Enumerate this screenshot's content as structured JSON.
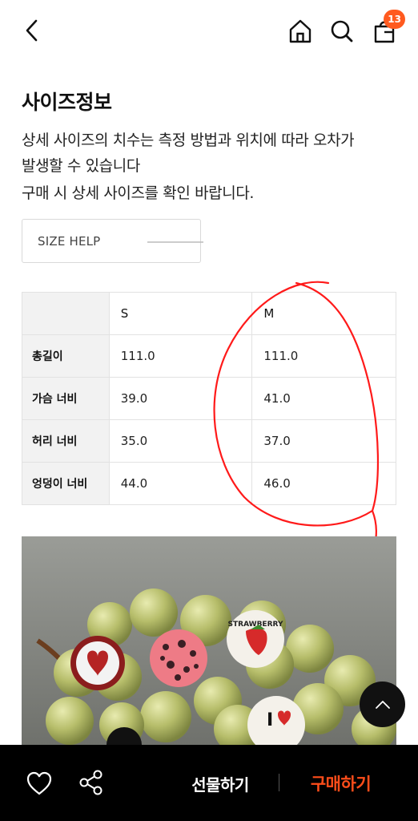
{
  "header": {
    "back_icon": "chevron-left-icon",
    "home_icon": "home-icon",
    "search_icon": "search-icon",
    "bag_icon": "shopping-bag-icon",
    "bag_count": "13",
    "badge_color": "#ff5a1f"
  },
  "size_info": {
    "title": "사이즈정보",
    "desc_line1": "상세 사이즈의 치수는 측정 방법과 위치에 따라 오차가",
    "desc_line2": "발생할 수 있습니다",
    "desc_line3": "구매 시 상세 사이즈를 확인 바랍니다.",
    "size_help_label": "SIZE HELP"
  },
  "size_table": {
    "columns": [
      "S",
      "M"
    ],
    "rows": [
      {
        "label": "총길이",
        "values": [
          "111.0",
          "111.0"
        ]
      },
      {
        "label": "가슴 너비",
        "values": [
          "39.0",
          "41.0"
        ]
      },
      {
        "label": "허리 너비",
        "values": [
          "35.0",
          "37.0"
        ]
      },
      {
        "label": "엉덩이 너비",
        "values": [
          "44.0",
          "46.0"
        ]
      }
    ],
    "annotation_color": "#ff1a1a"
  },
  "product_photo": {
    "pin_label_1": "STRAWBERRY",
    "pin_label_2": "I"
  },
  "scroll_top_icon": "chevron-up-icon",
  "bottom_bar": {
    "like_icon": "heart-icon",
    "share_icon": "share-icon",
    "gift_label": "선물하기",
    "buy_label": "구매하기",
    "buy_color": "#ff4d1a"
  }
}
